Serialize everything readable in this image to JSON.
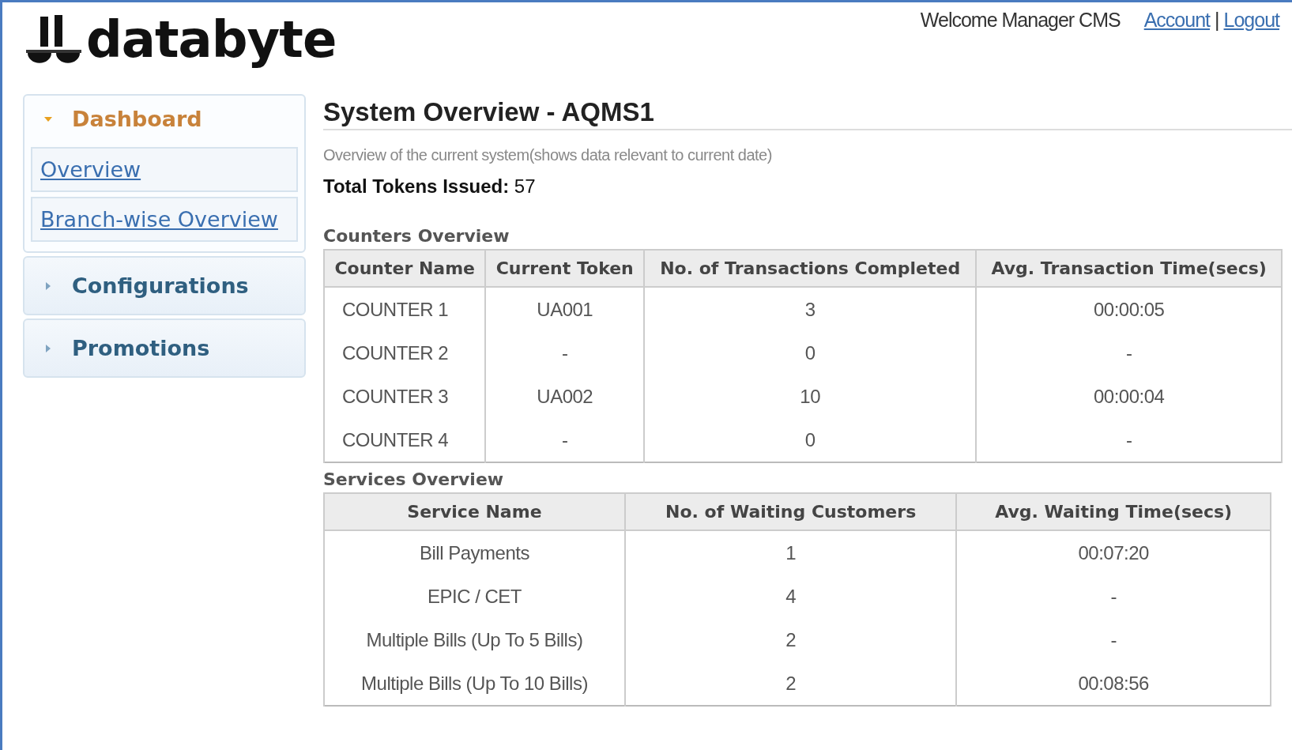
{
  "logo": {
    "text": "databyte"
  },
  "header": {
    "welcome": "Welcome Manager CMS",
    "links": [
      "Account",
      "Logout"
    ],
    "separator": "|"
  },
  "sidebar": {
    "sections": [
      {
        "label": "Dashboard",
        "expanded": true,
        "items": [
          {
            "label": "Overview"
          },
          {
            "label": "Branch-wise Overview"
          }
        ]
      },
      {
        "label": "Configurations",
        "expanded": false
      },
      {
        "label": "Promotions",
        "expanded": false
      }
    ]
  },
  "main": {
    "title": "System Overview - AQMS1",
    "subtitle": "Overview of the current system(shows data relevant to current date)",
    "total_label": "Total Tokens Issued:",
    "total_value": "57"
  },
  "counters": {
    "heading": "Counters Overview",
    "columns": [
      "Counter Name",
      "Current Token",
      "No. of Transactions Completed",
      "Avg. Transaction Time(secs)"
    ],
    "rows": [
      [
        "COUNTER 1",
        "UA001",
        "3",
        "00:00:05"
      ],
      [
        "COUNTER 2",
        "-",
        "0",
        "-"
      ],
      [
        "COUNTER 3",
        "UA002",
        "10",
        "00:00:04"
      ],
      [
        "COUNTER 4",
        "-",
        "0",
        "-"
      ]
    ]
  },
  "services": {
    "heading": "Services Overview",
    "columns": [
      "Service Name",
      "No. of Waiting Customers",
      "Avg. Waiting Time(secs)"
    ],
    "rows": [
      [
        "Bill Payments",
        "1",
        "00:07:20"
      ],
      [
        "EPIC / CET",
        "4",
        "-"
      ],
      [
        "Multiple Bills (Up To 5 Bills)",
        "2",
        "-"
      ],
      [
        "Multiple Bills (Up To 10 Bills)",
        "2",
        "00:08:56"
      ]
    ]
  }
}
